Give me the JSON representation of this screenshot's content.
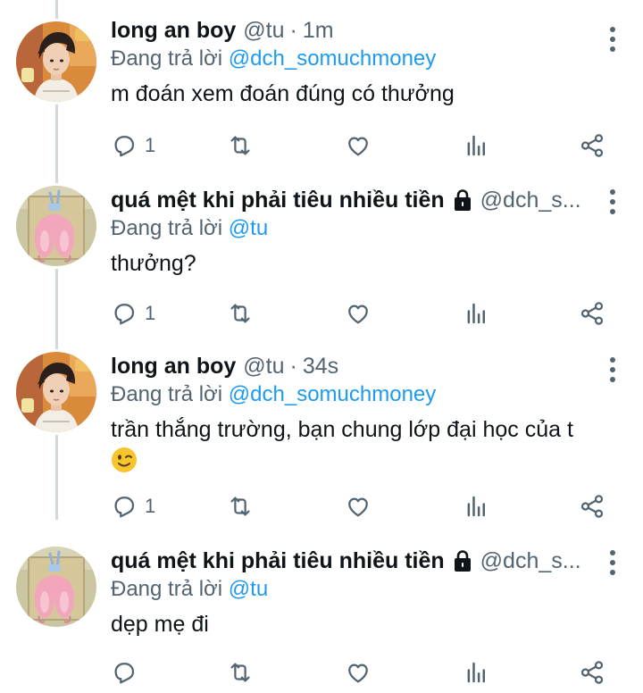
{
  "reply_prefix": "Đang trả lời",
  "tweets": [
    {
      "display_name": "long an boy",
      "handle": "@tu",
      "separator": "·",
      "time": "1m",
      "reply_to": "@dch_somuchmoney",
      "text": "m đoán xem đoán đúng có thưởng",
      "reply_count": "1",
      "avatar": "photo-boy-avatar"
    },
    {
      "display_name": "quá mệt khi phải tiêu nhiều tiền",
      "handle": "@dch_s...",
      "locked": true,
      "reply_to": "@tu",
      "text": "thưởng?",
      "reply_count": "1",
      "avatar": "pink-bunny-avatar"
    },
    {
      "display_name": "long an boy",
      "handle": "@tu",
      "separator": "·",
      "time": "34s",
      "reply_to": "@dch_somuchmoney",
      "text": "trần thắng trường, bạn chung lớp đại học của t",
      "emoji": "winking-face-emoji",
      "reply_count": "1",
      "avatar": "photo-boy-avatar"
    },
    {
      "display_name": "quá mệt khi phải tiêu nhiều tiền",
      "handle": "@dch_s...",
      "locked": true,
      "reply_to": "@tu",
      "text": "dẹp mẹ đi",
      "reply_count": "",
      "avatar": "pink-bunny-avatar"
    }
  ],
  "colors": {
    "link": "#1d9bf0",
    "secondary_text": "#536471",
    "thread_line": "#cfd9de"
  }
}
